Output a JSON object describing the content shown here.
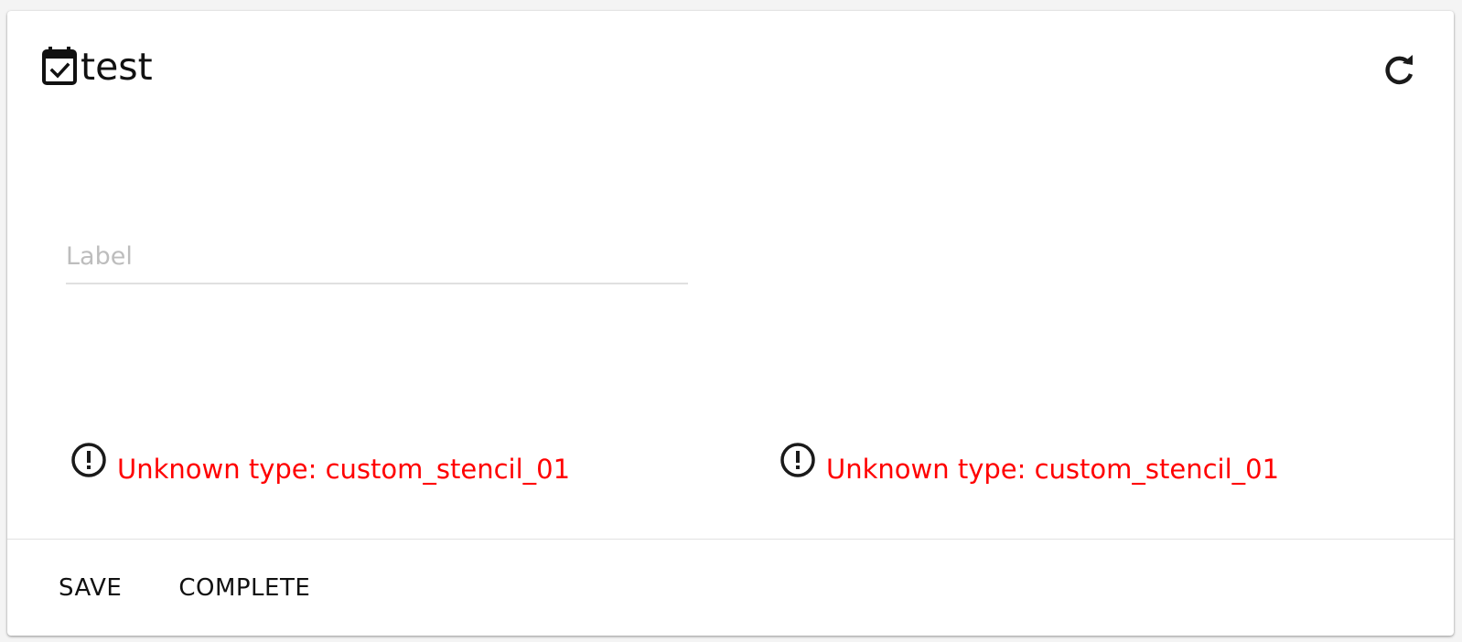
{
  "header": {
    "title": "test",
    "icon": "calendar-check-icon",
    "refresh_icon": "refresh-icon"
  },
  "form": {
    "label_placeholder": "Label",
    "label_value": ""
  },
  "errors": [
    {
      "icon": "alert-circle-icon",
      "text": "Unknown type: custom_stencil_01"
    },
    {
      "icon": "alert-circle-icon",
      "text": "Unknown type: custom_stencil_01"
    }
  ],
  "actions": {
    "save_label": "SAVE",
    "complete_label": "COMPLETE"
  },
  "colors": {
    "error": "#ff0000",
    "divider": "#e2e2e2",
    "placeholder": "#bdbdbd"
  }
}
